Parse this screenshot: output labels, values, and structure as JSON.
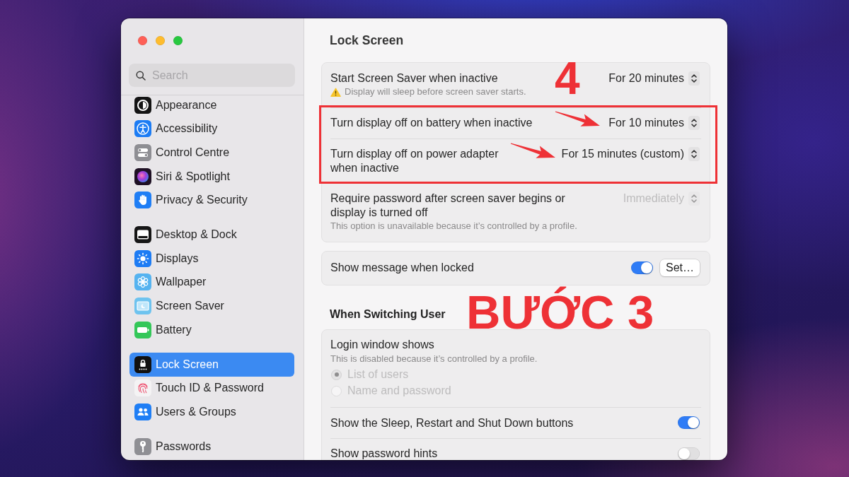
{
  "sidebar": {
    "search": {
      "placeholder": "Search"
    },
    "groups": [
      {
        "items": [
          {
            "label": "Appearance",
            "selected": false
          },
          {
            "label": "Accessibility",
            "selected": false
          },
          {
            "label": "Control Centre",
            "selected": false
          },
          {
            "label": "Siri & Spotlight",
            "selected": false
          },
          {
            "label": "Privacy & Security",
            "selected": false
          }
        ]
      },
      {
        "items": [
          {
            "label": "Desktop & Dock",
            "selected": false
          },
          {
            "label": "Displays",
            "selected": false
          },
          {
            "label": "Wallpaper",
            "selected": false
          },
          {
            "label": "Screen Saver",
            "selected": false
          },
          {
            "label": "Battery",
            "selected": false
          }
        ]
      },
      {
        "items": [
          {
            "label": "Lock Screen",
            "selected": true
          },
          {
            "label": "Touch ID & Password",
            "selected": false
          },
          {
            "label": "Users & Groups",
            "selected": false
          }
        ]
      },
      {
        "items": [
          {
            "label": "Passwords",
            "selected": false
          }
        ]
      }
    ]
  },
  "content": {
    "title": "Lock Screen",
    "sections": [
      {
        "cards": [
          {
            "rows": [
              {
                "kind": "select",
                "label": "Start Screen Saver when inactive",
                "note": {
                  "kind": "warning",
                  "text": "Display will sleep before screen saver starts."
                },
                "value": "For 20 minutes",
                "disabled": false
              },
              {
                "kind": "select",
                "label": "Turn display off on battery when inactive",
                "value": "For 10 minutes",
                "disabled": false
              },
              {
                "kind": "select",
                "label": "Turn display off on power adapter when inactive",
                "value": "For 15 minutes (custom)",
                "disabled": false
              },
              {
                "kind": "select",
                "label": "Require password after screen saver begins or display is turned off",
                "note": {
                  "kind": "info",
                  "text": "This option is unavailable because it’s controlled by a profile."
                },
                "value": "Immediately",
                "disabled": true
              }
            ]
          },
          {
            "rows": [
              {
                "kind": "toggle",
                "label": "Show message when locked",
                "on": true,
                "button": "Set…",
                "disabled": false
              }
            ]
          }
        ]
      },
      {
        "title": "When Switching User",
        "cards": [
          {
            "rows": [
              {
                "kind": "radio",
                "label": "Login window shows",
                "note": {
                  "kind": "info",
                  "text": "This is disabled because it’s controlled by a profile."
                },
                "disabled": true,
                "options": [
                  {
                    "label": "List of users",
                    "selected": true
                  },
                  {
                    "label": "Name and password",
                    "selected": false
                  }
                ]
              },
              {
                "kind": "toggle",
                "label": "Show the Sleep, Restart and Shut Down buttons",
                "on": true,
                "disabled": false
              },
              {
                "kind": "toggle",
                "label": "Show password hints",
                "on": false,
                "disabled": false
              }
            ]
          }
        ]
      }
    ]
  },
  "annotations": {
    "step_number": "4",
    "step_title": "BƯỚC 3"
  }
}
